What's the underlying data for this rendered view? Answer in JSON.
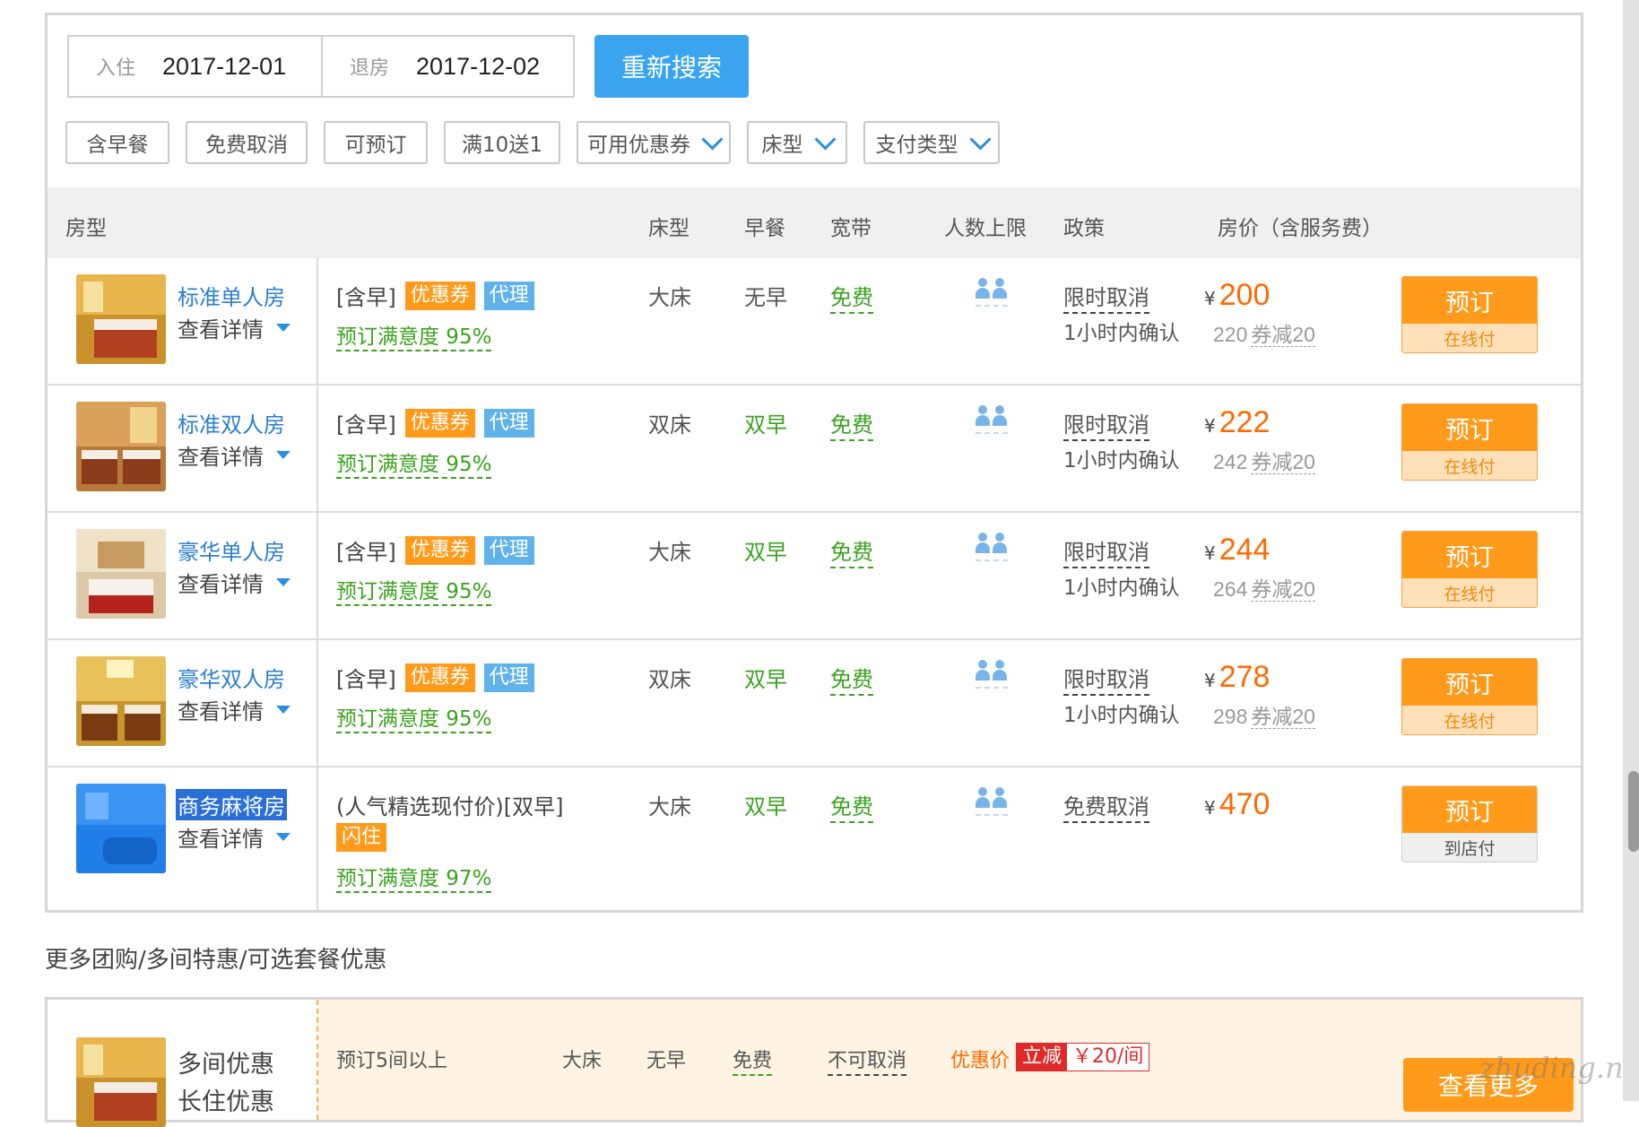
{
  "search": {
    "checkin_label": "入住",
    "checkin_date": "2017-12-01",
    "checkout_label": "退房",
    "checkout_date": "2017-12-02",
    "button": "重新搜索"
  },
  "filters": [
    "含早餐",
    "免费取消",
    "可预订",
    "满10送1",
    "可用优惠券",
    "床型",
    "支付类型"
  ],
  "table_headers": {
    "room": "房型",
    "bed": "床型",
    "breakfast": "早餐",
    "broadband": "宽带",
    "max_people": "人数上限",
    "policy": "政策",
    "price": "房价（含服务费）"
  },
  "rooms": [
    {
      "name": "标准单人房",
      "detail": "查看详情",
      "package": "[含早]",
      "tag1": "优惠券",
      "tag2": "代理",
      "satisfaction": "预订满意度 95%",
      "bed": "大床",
      "breakfast": "无早",
      "broadband": "免费",
      "policy": "限时取消",
      "confirm": "1小时内确认",
      "currency": "¥",
      "price": "200",
      "original": "220",
      "coupon": "券减20",
      "book": "预订",
      "pay": "在线付"
    },
    {
      "name": "标准双人房",
      "detail": "查看详情",
      "package": "[含早]",
      "tag1": "优惠券",
      "tag2": "代理",
      "satisfaction": "预订满意度 95%",
      "bed": "双床",
      "breakfast": "双早",
      "broadband": "免费",
      "policy": "限时取消",
      "confirm": "1小时内确认",
      "currency": "¥",
      "price": "222",
      "original": "242",
      "coupon": "券减20",
      "book": "预订",
      "pay": "在线付"
    },
    {
      "name": "豪华单人房",
      "detail": "查看详情",
      "package": "[含早]",
      "tag1": "优惠券",
      "tag2": "代理",
      "satisfaction": "预订满意度 95%",
      "bed": "大床",
      "breakfast": "双早",
      "broadband": "免费",
      "policy": "限时取消",
      "confirm": "1小时内确认",
      "currency": "¥",
      "price": "244",
      "original": "264",
      "coupon": "券减20",
      "book": "预订",
      "pay": "在线付"
    },
    {
      "name": "豪华双人房",
      "detail": "查看详情",
      "package": "[含早]",
      "tag1": "优惠券",
      "tag2": "代理",
      "satisfaction": "预订满意度 95%",
      "bed": "双床",
      "breakfast": "双早",
      "broadband": "免费",
      "policy": "限时取消",
      "confirm": "1小时内确认",
      "currency": "¥",
      "price": "278",
      "original": "298",
      "coupon": "券减20",
      "book": "预订",
      "pay": "在线付"
    },
    {
      "name": "商务麻将房",
      "detail": "查看详情",
      "package": "(人气精选现付价)[双早]",
      "tag1": "闪住",
      "satisfaction": "预订满意度 97%",
      "bed": "大床",
      "breakfast": "双早",
      "broadband": "免费",
      "policy": "免费取消",
      "currency": "¥",
      "price": "470",
      "book": "预订",
      "pay": "到店付"
    }
  ],
  "more_section": {
    "title": "更多团购/多间特惠/可选套餐优惠",
    "name": "多间优惠",
    "name_sub": "长住优惠",
    "desc": "预订5间以上",
    "bed": "大床",
    "breakfast": "无早",
    "broadband": "免费",
    "policy": "不可取消",
    "price_label": "优惠价",
    "cut_label": "立减",
    "cut_value": "￥20/间",
    "more_button": "查看更多"
  },
  "watermark": "zhuding.net",
  "colors": {
    "accent": "#3aa4f0",
    "orange": "#ff9a1a",
    "price": "#ff6a00",
    "green": "#3aa31f"
  }
}
